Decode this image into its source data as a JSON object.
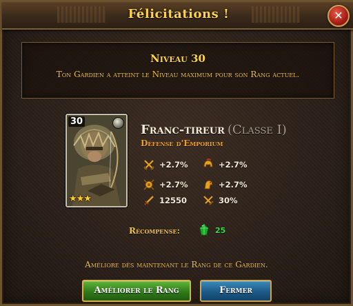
{
  "dialog": {
    "title": "Félicitations !",
    "close_icon": "close-icon"
  },
  "level": {
    "title": "Niveau 30",
    "description": "Ton Gardien a atteint le Niveau maximum pour son Rang actuel."
  },
  "guardian": {
    "card_level": "30",
    "stars": "★★★",
    "name": "Franc-tireur",
    "class": "(Classe I)",
    "subtitle": "Défense d'Emporium",
    "stats": [
      {
        "icon": "crossed-swords-icon",
        "value": "+2.7%"
      },
      {
        "icon": "helmet-icon",
        "value": "+2.7%"
      },
      {
        "icon": "shield-swords-icon",
        "value": "+2.7%"
      },
      {
        "icon": "horse-helmet-icon",
        "value": "+2.7%"
      },
      {
        "icon": "sword-icon",
        "value": "12550"
      },
      {
        "icon": "critical-swords-icon",
        "value": "30%"
      }
    ]
  },
  "reward": {
    "label": "Récompense:",
    "icon": "emerald-icon",
    "value": "25"
  },
  "hint": "Améliore dès maintenant le Rang de ce Gardien.",
  "buttons": {
    "upgrade": "Améliorer le Rang",
    "close": "Fermer"
  },
  "colors": {
    "title": "#ffd24a",
    "subtitle": "#f0a020",
    "reward_value": "#30e040",
    "upgrade_button": "#2f7a1a",
    "close_button": "#1c5a88"
  }
}
